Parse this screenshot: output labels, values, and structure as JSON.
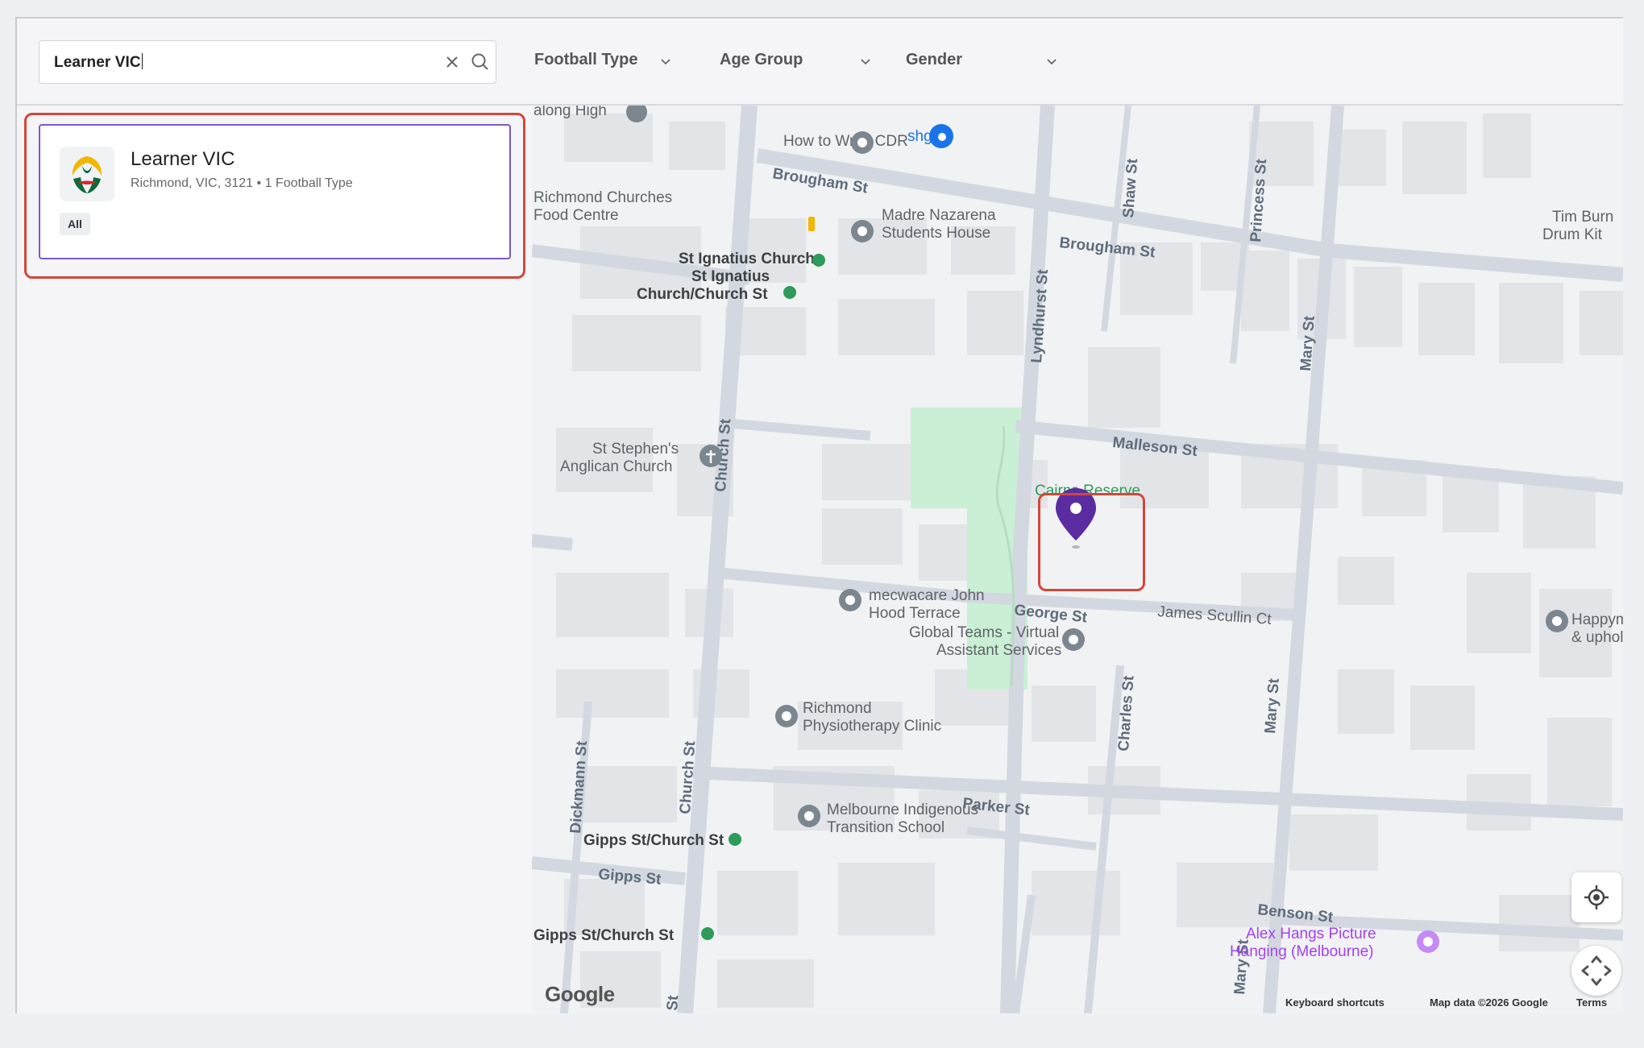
{
  "search": {
    "value": "Learner VIC"
  },
  "filters": [
    {
      "label": "Football Type"
    },
    {
      "label": "Age Group"
    },
    {
      "label": "Gender"
    }
  ],
  "results": [
    {
      "name": "Learner VIC",
      "subtitle": "Richmond, VIC, 3121 • 1 Football Type",
      "tag": "All"
    }
  ],
  "map": {
    "places": {
      "p1": "How to Write CDR",
      "p2": "shguf",
      "p3": "Richmond Churches",
      "p3b": "Food Centre",
      "p4": "Madre Nazarena",
      "p4b": "Students House",
      "p5": "St Ignatius Church",
      "p6": "St Ignatius",
      "p6b": "Church/Church St",
      "p7": "St Stephen's",
      "p7b": "Anglican Church",
      "p8": "Cairns Reserve",
      "p9": "mecwacare John",
      "p9b": "Hood Terrace",
      "p10": "Global Teams - Virtual",
      "p10b": "Assistant Services",
      "p11": "Richmond",
      "p11b": "Physiotherapy Clinic",
      "p12": "Melbourne Indigenous",
      "p12b": "Transition School",
      "p13": "Gipps St/Church St",
      "p14": "Gipps St/Church St",
      "p15": "Alex Hangs Picture",
      "p15b": "Hanging (Melbourne)",
      "p16": "Tim Burn",
      "p16b": "Drum Kit",
      "p17": "Happym",
      "p17b": "& uphol",
      "p18": "along High"
    },
    "streets": {
      "s1": "Brougham St",
      "s2": "Brougham St",
      "s3": "Malleson St",
      "s4": "George St",
      "s5": "James Scullin Ct",
      "s6": "Parker St",
      "s7": "Gipps St",
      "s8": "Benson St",
      "s9": "Church St",
      "s10": "Church St",
      "s11": "Lyndhurst St",
      "s12": "Shaw St",
      "s13": "Princess St",
      "s14": "Mary St",
      "s15": "Mary St",
      "s16": "Mary St",
      "s17": "Charles St",
      "s18": "Dickmann St",
      "s19": "St"
    },
    "google_logo": "Google",
    "footer": {
      "shortcuts": "Keyboard shortcuts",
      "attribution": "Map data ©2026 Google",
      "terms": "Terms"
    }
  }
}
